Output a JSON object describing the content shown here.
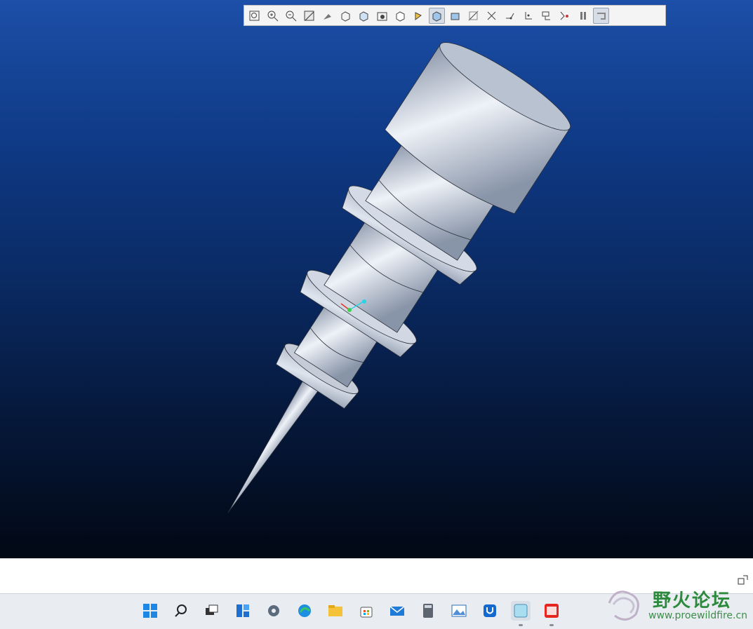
{
  "toolbar": {
    "buttons": [
      {
        "icon": "refit-icon"
      },
      {
        "icon": "zoom-in-icon"
      },
      {
        "icon": "zoom-out-icon"
      },
      {
        "icon": "repaint-icon"
      },
      {
        "icon": "spin-center-icon"
      },
      {
        "icon": "view-manager-icon"
      },
      {
        "icon": "saved-orientations-icon"
      },
      {
        "icon": "appearance-gallery-icon"
      },
      {
        "icon": "display-style-icon"
      },
      {
        "icon": "orient-mode-icon"
      },
      {
        "icon": "shading-icon"
      },
      {
        "icon": "perspective-icon"
      },
      {
        "icon": "plane-display-icon"
      },
      {
        "icon": "axis-display-icon"
      },
      {
        "icon": "point-display-icon"
      },
      {
        "icon": "csys-display-icon"
      },
      {
        "icon": "annotation-display-icon"
      },
      {
        "icon": "spin-center-display-icon"
      },
      {
        "icon": "pause-icon"
      },
      {
        "icon": "regenerate-icon"
      }
    ],
    "active_index": [
      10,
      19
    ]
  },
  "message_area": {
    "text": ""
  },
  "taskbar": {
    "apps": [
      {
        "icon": "start-icon"
      },
      {
        "icon": "search-icon"
      },
      {
        "icon": "task-view-icon"
      },
      {
        "icon": "widgets-icon"
      },
      {
        "icon": "settings-icon"
      },
      {
        "icon": "edge-icon"
      },
      {
        "icon": "file-explorer-icon"
      },
      {
        "icon": "store-icon"
      },
      {
        "icon": "mail-icon"
      },
      {
        "icon": "calculator-icon"
      },
      {
        "icon": "photos-icon"
      },
      {
        "icon": "app-u-icon"
      },
      {
        "icon": "creo-icon"
      },
      {
        "icon": "pingan-securities-icon"
      }
    ]
  },
  "watermark": {
    "title": "野火论坛",
    "url": "www.proewildfire.cn"
  },
  "colors": {
    "viewport_top": "#1c4fa8",
    "viewport_bottom": "#020814",
    "model_light": "#c6cfdd",
    "model_dark": "#7f8ba0"
  }
}
